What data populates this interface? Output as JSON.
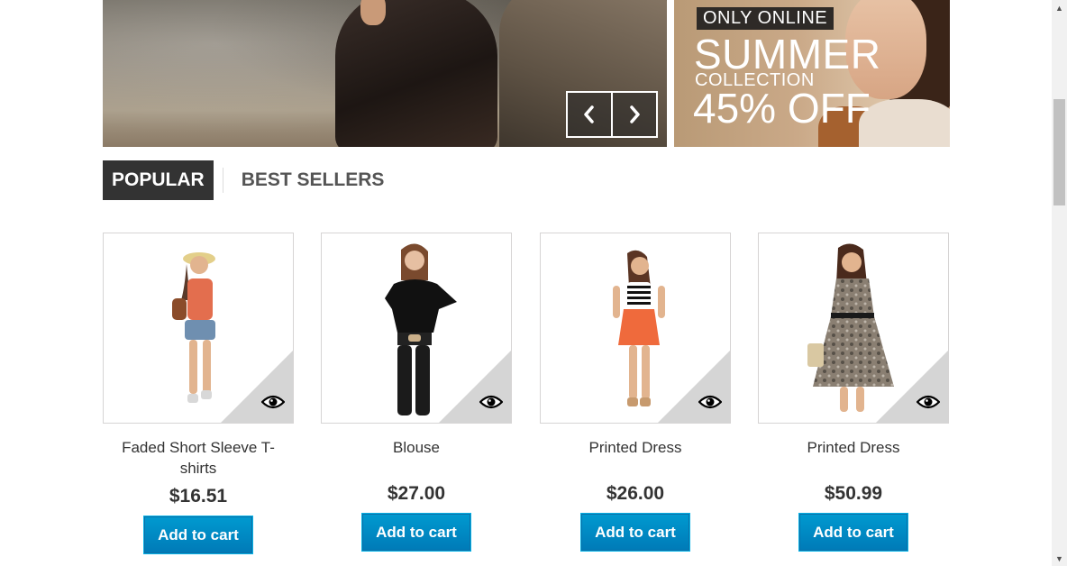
{
  "banner": {
    "promo_tag": "ONLY ONLINE",
    "promo_title": "SUMMER",
    "promo_subtitle": "COLLECTION",
    "promo_discount": "45% OFF",
    "prev_icon": "chevron-left-icon",
    "next_icon": "chevron-right-icon"
  },
  "tabs": [
    {
      "label": "POPULAR",
      "active": true
    },
    {
      "label": "BEST SELLERS",
      "active": false
    }
  ],
  "products": [
    {
      "name": "Faded Short Sleeve T-shirts",
      "price": "$16.51",
      "cart_label": "Add to cart",
      "quick_view_icon": "eye-icon"
    },
    {
      "name": "Blouse",
      "price": "$27.00",
      "cart_label": "Add to cart",
      "quick_view_icon": "eye-icon"
    },
    {
      "name": "Printed Dress",
      "price": "$26.00",
      "cart_label": "Add to cart",
      "quick_view_icon": "eye-icon"
    },
    {
      "name": "Printed Dress",
      "price": "$50.99",
      "cart_label": "Add to cart",
      "quick_view_icon": "eye-icon"
    }
  ],
  "colors": {
    "accent": "#0088c8",
    "tab_active": "#333333"
  }
}
